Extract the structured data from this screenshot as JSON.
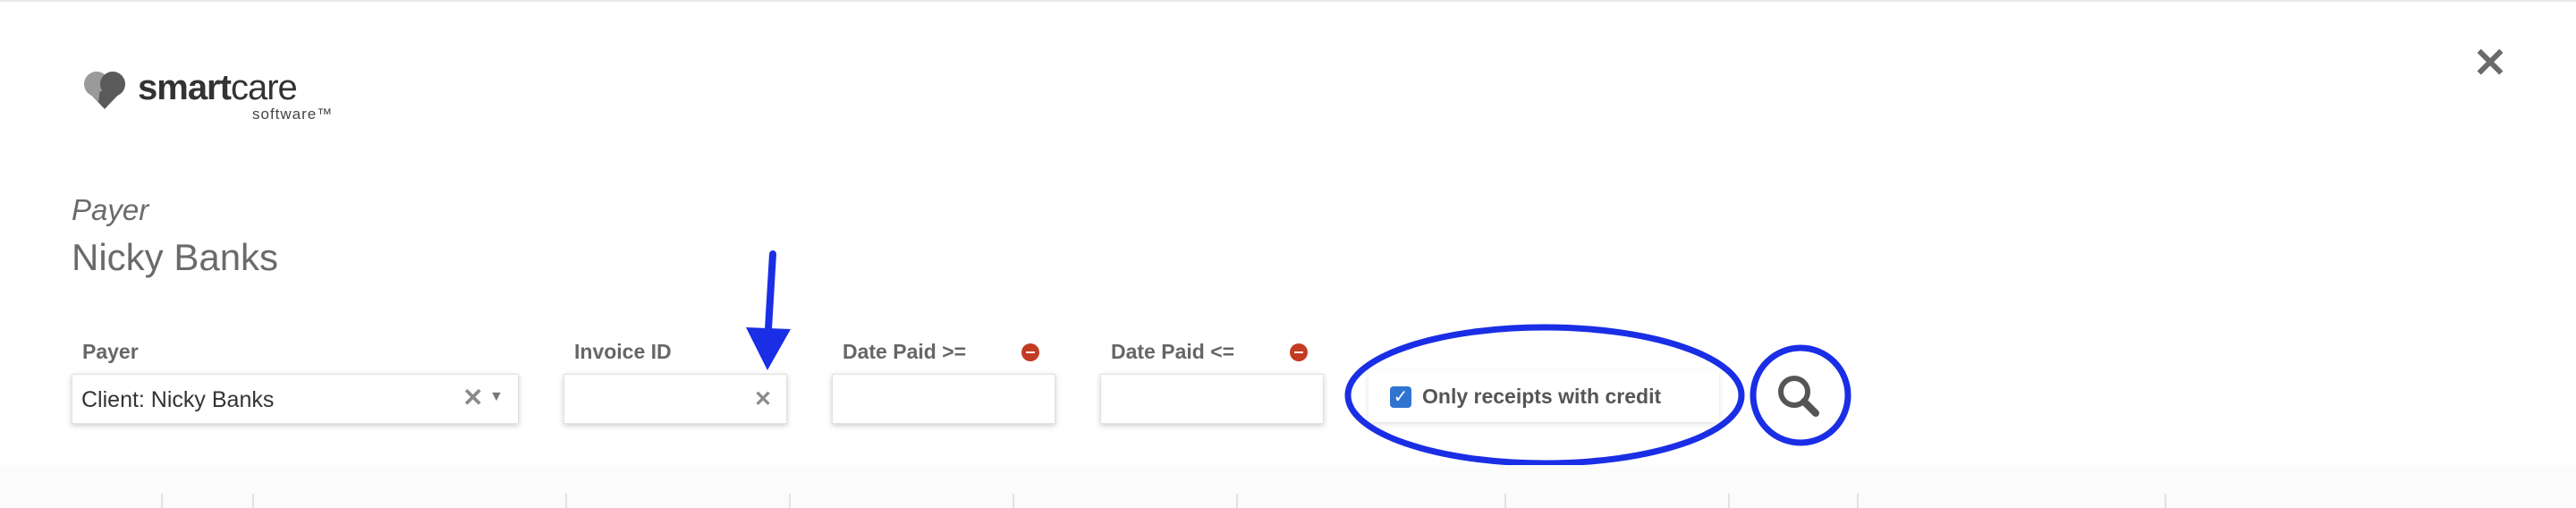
{
  "brand": {
    "word_bold": "smart",
    "word_light": "care",
    "subtitle": "software™"
  },
  "header": {
    "payer_caption": "Payer",
    "payer_name": "Nicky Banks"
  },
  "filters": {
    "payer": {
      "label": "Payer",
      "value": "Client: Nicky Banks"
    },
    "invoice_id": {
      "label": "Invoice ID",
      "value": ""
    },
    "date_paid_from": {
      "label": "Date Paid >=",
      "value": ""
    },
    "date_paid_to": {
      "label": "Date Paid <=",
      "value": ""
    },
    "only_credit": {
      "label": "Only receipts with credit",
      "checked": true
    }
  },
  "icons": {
    "close": "close-icon",
    "search": "search-icon",
    "clear": "clear-icon",
    "dropdown": "chevron-down-icon",
    "remove": "minus-circle-icon"
  },
  "colors": {
    "annotation": "#1a2ee6",
    "remove": "#c23b22",
    "checkbox": "#2f74d0"
  }
}
